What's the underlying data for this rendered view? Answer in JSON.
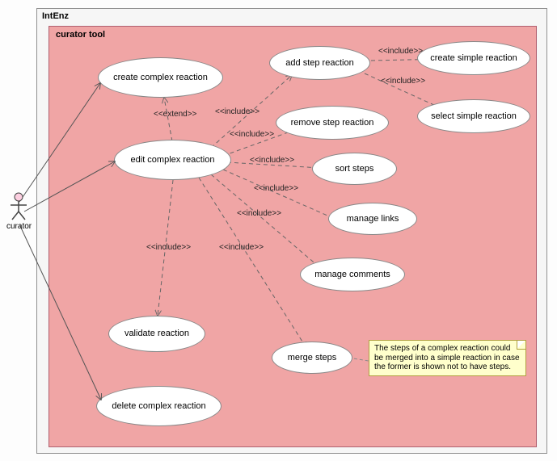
{
  "outer_box": {
    "title": "IntEnz"
  },
  "inner_box": {
    "title": "curator tool"
  },
  "actor": {
    "label": "curator"
  },
  "usecases": {
    "create_complex": {
      "label": "create complex reaction"
    },
    "edit_complex": {
      "label": "edit complex reaction"
    },
    "delete_complex": {
      "label": "delete complex reaction"
    },
    "validate": {
      "label": "validate reaction"
    },
    "add_step": {
      "label": "add step reaction"
    },
    "remove_step": {
      "label": "remove step reaction"
    },
    "sort_steps": {
      "label": "sort steps"
    },
    "manage_links": {
      "label": "manage links"
    },
    "manage_comments": {
      "label": "manage comments"
    },
    "merge_steps": {
      "label": "merge steps"
    },
    "create_simple": {
      "label": "create simple reaction"
    },
    "select_simple": {
      "label": "select simple reaction"
    }
  },
  "stereotypes": {
    "extend": "<<extend>>",
    "include1": "<<include>>",
    "include2": "<<include>>",
    "include3": "<<include>>",
    "include4": "<<include>>",
    "include5": "<<include>>",
    "include6": "<<include>>",
    "include7": "<<include>>",
    "include8": "<<include>>",
    "include9": "<<include>>"
  },
  "note": {
    "text": "The steps of a complex reaction could be merged into a simple reaction in case the former is shown not to have steps."
  },
  "chart_data": {
    "type": "diagram",
    "diagram_type": "UML use case diagram",
    "subject_boxes": [
      "IntEnz",
      "curator tool"
    ],
    "actors": [
      "curator"
    ],
    "use_cases": [
      "create complex reaction",
      "edit complex reaction",
      "delete complex reaction",
      "validate reaction",
      "add step reaction",
      "remove step reaction",
      "sort steps",
      "manage links",
      "manage comments",
      "merge steps",
      "create simple reaction",
      "select simple reaction"
    ],
    "associations": [
      {
        "from": "curator",
        "to": "create complex reaction",
        "type": "association"
      },
      {
        "from": "curator",
        "to": "edit complex reaction",
        "type": "association"
      },
      {
        "from": "curator",
        "to": "delete complex reaction",
        "type": "association"
      },
      {
        "from": "create complex reaction",
        "to": "edit complex reaction",
        "type": "extend"
      },
      {
        "from": "edit complex reaction",
        "to": "add step reaction",
        "type": "include"
      },
      {
        "from": "edit complex reaction",
        "to": "remove step reaction",
        "type": "include"
      },
      {
        "from": "edit complex reaction",
        "to": "sort steps",
        "type": "include"
      },
      {
        "from": "edit complex reaction",
        "to": "manage links",
        "type": "include"
      },
      {
        "from": "edit complex reaction",
        "to": "manage comments",
        "type": "include"
      },
      {
        "from": "edit complex reaction",
        "to": "merge steps",
        "type": "include"
      },
      {
        "from": "edit complex reaction",
        "to": "validate reaction",
        "type": "include"
      },
      {
        "from": "add step reaction",
        "to": "create simple reaction",
        "type": "include"
      },
      {
        "from": "add step reaction",
        "to": "select simple reaction",
        "type": "include"
      }
    ],
    "notes": [
      {
        "text": "The steps of a complex reaction could be merged into a simple reaction in case the former is shown not to have steps.",
        "attached_to": "merge steps"
      }
    ]
  }
}
